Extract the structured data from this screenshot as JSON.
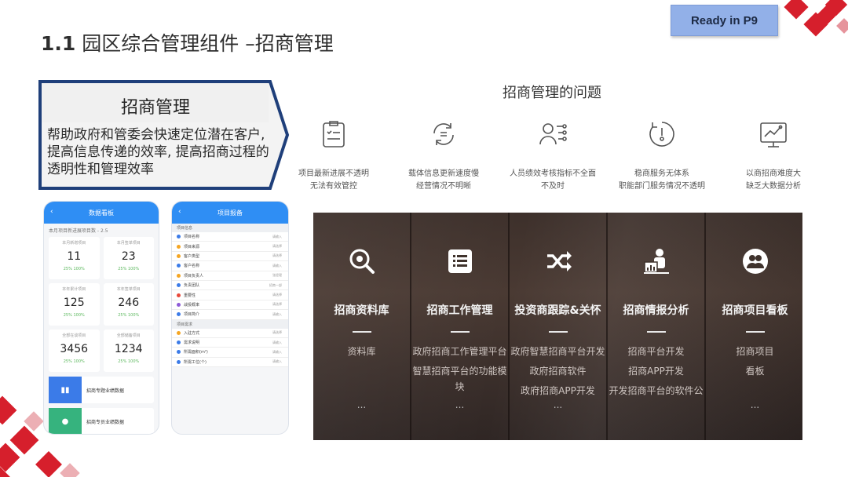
{
  "slide": {
    "title_num": "1.1",
    "title_text": "园区综合管理组件 –招商管理",
    "ready_badge": "Ready in P9"
  },
  "callout": {
    "title": "招商管理",
    "text": "帮助政府和管委会快速定位潜在客户,提高信息传递的效率, 提高招商过程的透明性和管理效率"
  },
  "problems": {
    "title": "招商管理的问题",
    "items": [
      {
        "icon": "checklist-icon",
        "line1": "项目最新进展不透明",
        "line2": "无法有效管控"
      },
      {
        "icon": "refresh-icon",
        "line1": "载体信息更新速度慢",
        "line2": "经营情况不明晰"
      },
      {
        "icon": "people-network-icon",
        "line1": "人员绩效考核指标不全面",
        "line2": "不及时"
      },
      {
        "icon": "clock-icon",
        "line1": "稳商服务无体系",
        "line2": "职能部门服务情况不透明"
      },
      {
        "icon": "chart-board-icon",
        "line1": "以商招商难度大",
        "line2": "缺乏大数据分析"
      }
    ]
  },
  "modules": [
    {
      "icon": "search-gear-icon",
      "title": "招商资料库",
      "items": [
        "资料库"
      ],
      "dots": "..."
    },
    {
      "icon": "list-icon",
      "title": "招商工作管理",
      "items": [
        "政府招商工作管理平台",
        "智慧招商平台的功能模",
        "块"
      ],
      "dots": "..."
    },
    {
      "icon": "shuffle-icon",
      "title": "投资商跟踪&关怀",
      "items": [
        "政府智慧招商平台开发",
        "政府招商软件",
        "政府招商APP开发"
      ],
      "dots": "..."
    },
    {
      "icon": "presenter-icon",
      "title": "招商情报分析",
      "items": [
        "招商平台开发",
        "招商APP开发",
        "开发招商平台的软件公"
      ],
      "dots": ""
    },
    {
      "icon": "group-icon",
      "title": "招商项目看板",
      "items": [
        "招商项目",
        "看板"
      ],
      "dots": "..."
    }
  ],
  "phone1": {
    "header": "数据看板",
    "subtitle": "本月项目新进展项目数 - 2.5",
    "cards": [
      {
        "label": "本月新增项目",
        "value": "11",
        "pct": "25% 100%"
      },
      {
        "label": "本月签单项目",
        "value": "23",
        "pct": "25% 100%"
      },
      {
        "label": "本年累计项目",
        "value": "125",
        "pct": "25% 100%"
      },
      {
        "label": "本年签单项目",
        "value": "246",
        "pct": "25% 100%"
      },
      {
        "label": "全部在谈项目",
        "value": "3456",
        "pct": "25% 100%"
      },
      {
        "label": "全部储备项目",
        "value": "1234",
        "pct": "25% 100%"
      }
    ],
    "buttons": [
      {
        "label": "招商专题业绩数据",
        "color": "#3b7be8"
      },
      {
        "label": "招商专员业绩数据",
        "color": "#36b37e"
      }
    ]
  },
  "phone2": {
    "header": "项目报备",
    "section1": "项目信息",
    "rows1": [
      {
        "label": "项目名称",
        "color": "#3b7be8",
        "val": "请输入"
      },
      {
        "label": "项目来源",
        "color": "#f5a623",
        "val": "请选择"
      },
      {
        "label": "客户类型",
        "color": "#f5a623",
        "val": "请选择"
      },
      {
        "label": "客户名称",
        "color": "#3b7be8",
        "val": "请输入"
      },
      {
        "label": "项目负责人",
        "color": "#f5a623",
        "val": "张经理"
      },
      {
        "label": "负责团队",
        "color": "#3b7be8",
        "val": "招商一部"
      },
      {
        "label": "重要性",
        "color": "#e8483b",
        "val": "请选择"
      },
      {
        "label": "战投概率",
        "color": "#8e5bd8",
        "val": "请选择"
      },
      {
        "label": "项目简介",
        "color": "#3b7be8",
        "val": "请输入"
      }
    ],
    "section2": "项目需求",
    "rows2": [
      {
        "label": "入驻方式",
        "color": "#f5a623",
        "val": "请选择"
      },
      {
        "label": "需求说明",
        "color": "#3b7be8",
        "val": "请输入"
      },
      {
        "label": "所需面积(m²)",
        "color": "#3b7be8",
        "val": "请输入"
      },
      {
        "label": "所需工位(个)",
        "color": "#3b7be8",
        "val": "请输入"
      }
    ]
  }
}
